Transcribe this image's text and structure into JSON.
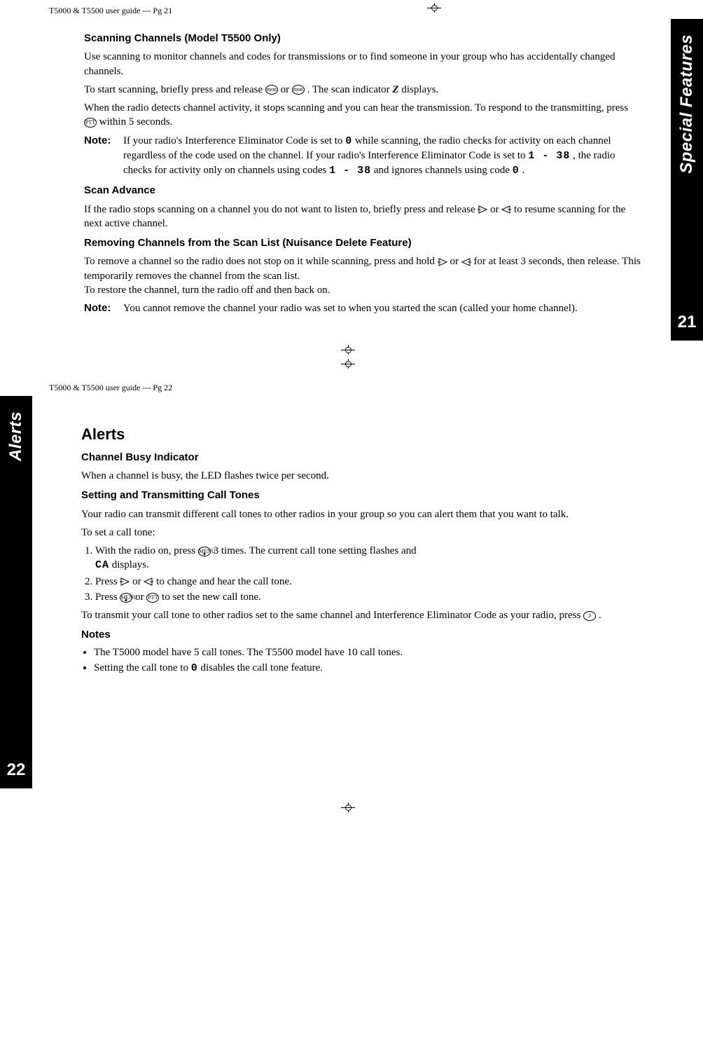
{
  "page21": {
    "header": "T5000  & T5500 user guide --- Pg 21",
    "tabLabel": "Special Features",
    "tabPage": "21",
    "h_scanningChannels": "Scanning Channels (Model T5500 Only)",
    "p_scanIntro": "Use scanning to monitor channels and codes for transmissions or to find someone in your group who has accidentally changed channels.",
    "p_startScan_a": "To start scanning, briefly press and release ",
    "p_startScan_b": " or ",
    "p_startScan_c": " . The scan indicator ",
    "p_startScan_d": " displays.",
    "p_detect_a": "When the radio detects channel activity, it stops scanning and you can hear the transmission. To respond to the transmitting, press ",
    "p_detect_b": " within 5 seconds.",
    "noteLabel": "Note:",
    "note1_a": "If your radio's Interference Eliminator Code is set to ",
    "note1_code0": "0",
    "note1_b": " while scanning, the radio checks for activity on each channel regardless of the code used on the channel. If your radio's Interference  Eliminator Code is set to ",
    "note1_range": "1 - 38",
    "note1_c": " , the radio checks for activity only on channels using codes ",
    "note1_range2": "1 - 38",
    "note1_d": " and ignores channels using code ",
    "note1_code0b": "0",
    "note1_e": ".",
    "h_scanAdvance": "Scan Advance",
    "p_scanAdvance_a": "If the radio stops scanning on a channel you do not want to listen to, briefly press and release  ",
    "p_scanAdvance_b": "  or  ",
    "p_scanAdvance_c": "   to resume scanning for the next active channel.",
    "h_removing": "Removing Channels from the Scan List (Nuisance Delete Feature)",
    "p_remove_a": "To remove a channel so the radio does not stop on it while scanning, press and hold  ",
    "p_remove_b": " or ",
    "p_remove_c": "  for at least 3 seconds, then release. This temporarily removes the channel from the scan list.",
    "p_restore": "To restore the channel, turn the radio off and then back on.",
    "note2": "You cannot remove the channel your radio was set to when you started the scan (called your home channel)."
  },
  "page22": {
    "header": "T5000  & T5500 user guide --- Pg 22",
    "tabLabel": "Alerts",
    "tabPage": "22",
    "h_alerts": "Alerts",
    "h_channelBusy": "Channel Busy Indicator",
    "p_channelBusy": "When a channel is busy, the LED flashes twice per second.",
    "h_settingCall": "Setting and Transmitting Call Tones",
    "p_callIntro": "Your radio can transmit different call tones to other radios in your group so you can alert them that you want to talk.",
    "p_toSet": "To set a call tone:",
    "step1_a": "With the radio on, press  ",
    "step1_b": "  3 times. The current call tone setting flashes and ",
    "step1_seg": "CA",
    "step1_c": " displays.",
    "step2_a": "Press  ",
    "step2_b": " or ",
    "step2_c": "  to change and hear the call tone.",
    "step3_a": "Press  ",
    "step3_b": "  or  ",
    "step3_c": "  to set the new call tone.",
    "p_transmit_a": "To transmit your call tone to other radios set to the same  channel and Interference Eliminator Code as your radio, press ",
    "p_transmit_b": "  .",
    "h_notes": "Notes",
    "bullet1": "The T5000 model have 5 call tones. The T5500 model have 10 call tones.",
    "bullet2_a": "Setting the call tone to ",
    "bullet2_seg": "0",
    "bullet2_b": " disables the call tone feature."
  },
  "icons": {
    "mon": "mon",
    "monArc": "mon",
    "ptt": "PTT",
    "menu": "MENU",
    "scanZ": "Z",
    "call": "♪"
  }
}
